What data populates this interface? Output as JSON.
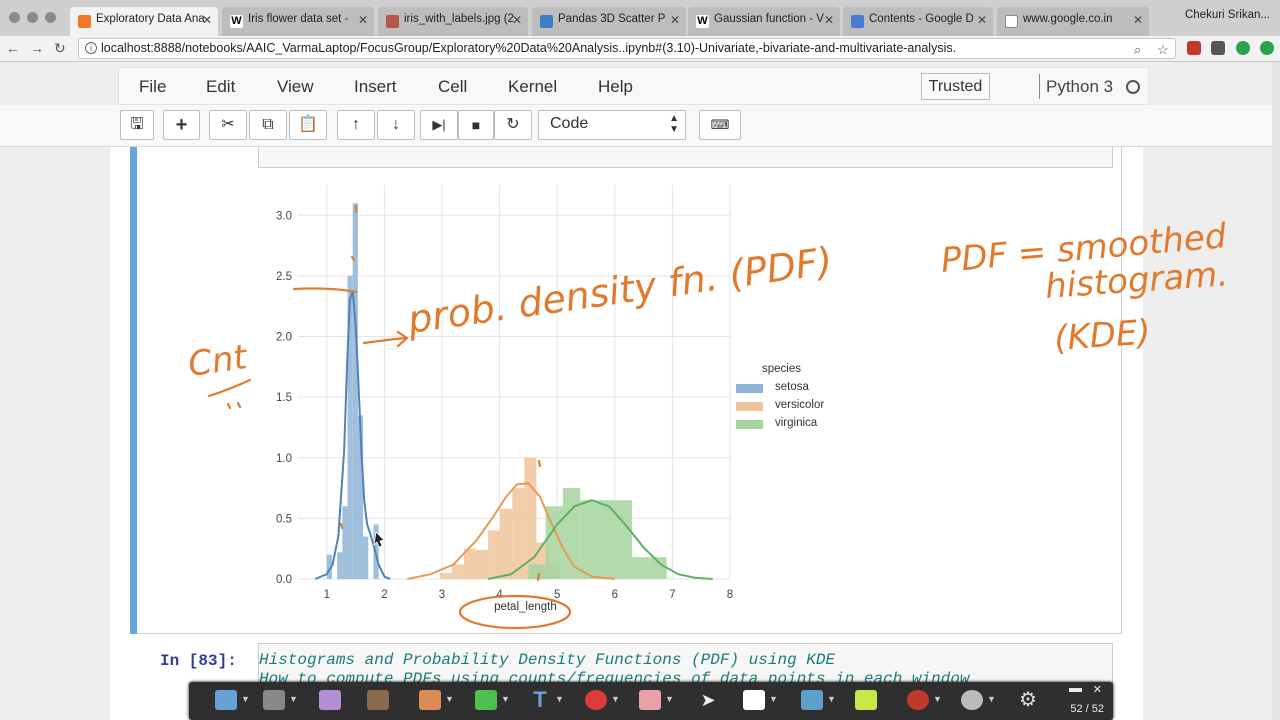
{
  "browser": {
    "tabs": [
      {
        "title": "Exploratory Data Ana",
        "active": true,
        "icon": "jupyter-icon"
      },
      {
        "title": "Iris flower data set -",
        "icon": "wikipedia-icon"
      },
      {
        "title": "iris_with_labels.jpg (2",
        "icon": "image-icon"
      },
      {
        "title": "Pandas 3D Scatter P",
        "icon": "chart-icon"
      },
      {
        "title": "Gaussian function - V",
        "icon": "wikipedia-icon"
      },
      {
        "title": "Contents - Google D",
        "icon": "docs-icon"
      },
      {
        "title": "www.google.co.in",
        "icon": "page-icon"
      }
    ],
    "profile": "Chekuri Srikan...",
    "url": "localhost:8888/notebooks/AAIC_VarmaLaptop/FocusGroup/Exploratory%20Data%20Analysis..ipynb#(3.10)-Univariate,-bivariate-and-multivariate-analysis."
  },
  "notebook": {
    "menu": [
      "File",
      "Edit",
      "View",
      "Insert",
      "Cell",
      "Kernel",
      "Help"
    ],
    "trusted": "Trusted",
    "kernel": "Python 3",
    "cell_type": "Code",
    "next_prompt": "In [83]:",
    "md_line1": "Histograms and Probability Density Functions (PDF) using KDE",
    "md_line2": "How to compute PDFs using counts/frequencies of data points in each window"
  },
  "chart_data": {
    "type": "bar",
    "xlabel": "petal_length",
    "ylabel": "",
    "xlim": [
      0.5,
      8
    ],
    "ylim": [
      0,
      3.25
    ],
    "xticks": [
      1,
      2,
      3,
      4,
      5,
      6,
      7,
      8
    ],
    "yticks": [
      0.0,
      0.5,
      1.0,
      1.5,
      2.0,
      2.5,
      3.0
    ],
    "legend_title": "species",
    "legend_position": "right",
    "grid": true,
    "series": [
      {
        "name": "setosa",
        "color": "#8fb4d6",
        "hist": {
          "bin_width": 0.09,
          "bins": [
            1.0,
            1.09,
            1.18,
            1.27,
            1.36,
            1.45,
            1.54,
            1.63,
            1.72,
            1.81
          ],
          "heights": [
            0.2,
            0.0,
            0.22,
            0.6,
            2.5,
            3.1,
            1.35,
            0.35,
            0.0,
            0.45
          ]
        },
        "kde": {
          "x": [
            0.8,
            1.0,
            1.1,
            1.2,
            1.3,
            1.35,
            1.4,
            1.45,
            1.5,
            1.55,
            1.6,
            1.65,
            1.7,
            1.75,
            1.8,
            1.9,
            2.0,
            2.1
          ],
          "y": [
            0.0,
            0.04,
            0.12,
            0.35,
            1.05,
            1.75,
            2.3,
            2.38,
            2.1,
            1.6,
            1.05,
            0.65,
            0.45,
            0.38,
            0.3,
            0.12,
            0.02,
            0.0
          ]
        }
      },
      {
        "name": "versicolor",
        "color": "#f0c49b",
        "hist": {
          "bin_width": 0.21,
          "bins": [
            2.96,
            3.17,
            3.38,
            3.59,
            3.8,
            4.01,
            4.22,
            4.43,
            4.64,
            4.85
          ],
          "heights": [
            0.05,
            0.12,
            0.25,
            0.24,
            0.4,
            0.58,
            0.75,
            1.0,
            0.3,
            0.12
          ]
        },
        "kde": {
          "x": [
            2.4,
            2.8,
            3.2,
            3.6,
            3.9,
            4.1,
            4.3,
            4.5,
            4.7,
            4.9,
            5.1,
            5.3,
            5.6,
            6.0
          ],
          "y": [
            0.0,
            0.04,
            0.12,
            0.32,
            0.52,
            0.67,
            0.78,
            0.79,
            0.68,
            0.46,
            0.25,
            0.1,
            0.02,
            0.0
          ]
        }
      },
      {
        "name": "virginica",
        "color": "#a6d49e",
        "hist": {
          "bin_width": 0.3,
          "bins": [
            4.5,
            4.8,
            5.1,
            5.4,
            5.7,
            6.0,
            6.3,
            6.6
          ],
          "heights": [
            0.12,
            0.6,
            0.75,
            0.65,
            0.65,
            0.65,
            0.18,
            0.18
          ]
        },
        "kde": {
          "x": [
            3.8,
            4.2,
            4.6,
            5.0,
            5.3,
            5.6,
            5.9,
            6.2,
            6.5,
            6.8,
            7.1,
            7.4,
            7.7
          ],
          "y": [
            0.0,
            0.04,
            0.18,
            0.45,
            0.6,
            0.65,
            0.6,
            0.44,
            0.26,
            0.12,
            0.04,
            0.01,
            0.0
          ]
        }
      }
    ]
  },
  "annotations": {
    "pdf_label": "prob. density fn. (PDF)",
    "cnt_label": "Cnt",
    "note_line1": "PDF = smoothed",
    "note_line2": "histogram.",
    "note_line3": "(KDE)"
  },
  "palette": {
    "page": "52 / 52"
  }
}
